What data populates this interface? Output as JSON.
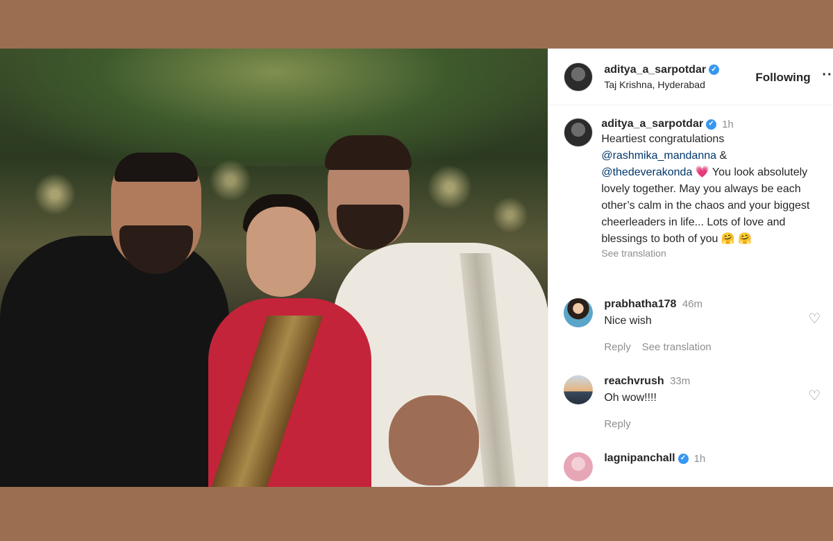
{
  "post": {
    "username": "aditya_a_sarpotdar",
    "location": "Taj Krishna, Hyderabad",
    "follow_label": "Following",
    "more_label": "···",
    "verified_mark": "✓"
  },
  "caption": {
    "username": "aditya_a_sarpotdar",
    "time": "1h",
    "intro": "Heartiest congratulations",
    "mention1": "@rashmika_mandanna",
    "amp": "&",
    "mention2": "@thedeverakonda",
    "heart": "💗",
    "rest": "You look absolutely lovely together. May you always be each other’s calm in the chaos and your biggest cheerleaders in life... Lots of love and blessings to both of you",
    "emoji": "🤗 🤗",
    "see_translation": "See translation"
  },
  "comments": [
    {
      "username": "prabhatha178",
      "time": "46m",
      "text": "Nice wish",
      "reply": "Reply",
      "see_translation": "See translation"
    },
    {
      "username": "reachvrush",
      "time": "33m",
      "text": "Oh wow!!!!",
      "reply": "Reply"
    },
    {
      "username": "lagnipanchall",
      "time": "1h"
    }
  ],
  "icons": {
    "like": "♡"
  },
  "colors": {
    "page_bg": "#9b6e51",
    "verified": "#3897f0",
    "mention": "#00376b",
    "secondary_text": "#8e8e8e"
  }
}
